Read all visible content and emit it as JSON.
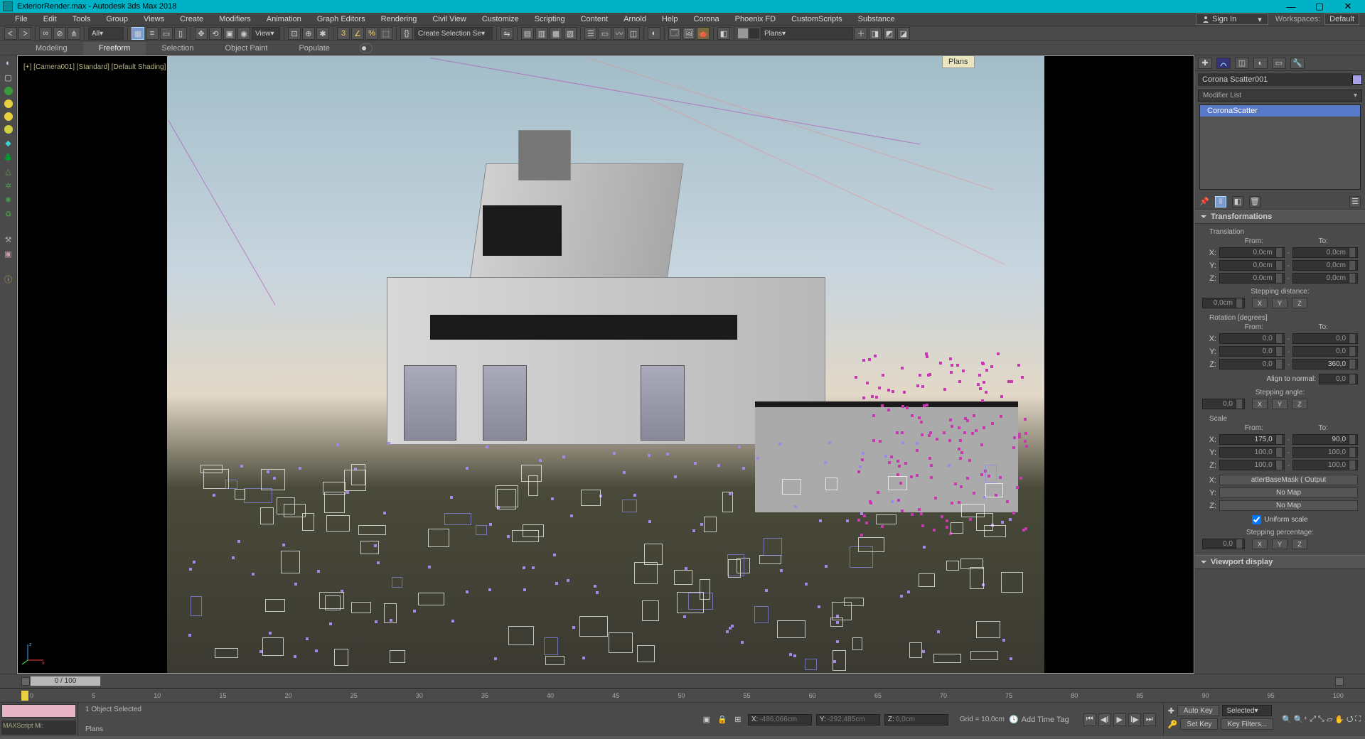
{
  "titlebar": {
    "filename": "ExteriorRender.max - Autodesk 3ds Max 2018"
  },
  "menu": [
    "File",
    "Edit",
    "Tools",
    "Group",
    "Views",
    "Create",
    "Modifiers",
    "Animation",
    "Graph Editors",
    "Rendering",
    "Civil View",
    "Customize",
    "Scripting",
    "Content",
    "Arnold",
    "Help",
    "Corona",
    "Phoenix FD",
    "CustomScripts",
    "Substance"
  ],
  "signin": "Sign In",
  "workspace": {
    "label": "Workspaces:",
    "value": "Default"
  },
  "toolbar": {
    "selset_drop": "All",
    "view_drop": "View",
    "create_sel": "Create Selection Se",
    "plans_drop": "Plans"
  },
  "ribbon": [
    "Modeling",
    "Freeform",
    "Selection",
    "Object Paint",
    "Populate"
  ],
  "ribbon_active": "Freeform",
  "tooltip": "Plans",
  "viewport_label": "[+] [Camera001] [Standard] [Default Shading]",
  "rightpanel": {
    "object_name": "Corona Scatter001",
    "mod_list_label": "Modifier List",
    "modifier": "CoronaScatter",
    "rollout": "Transformations",
    "translation": {
      "label": "Translation",
      "from": "From:",
      "to": "To:",
      "x_from": "0,0cm",
      "x_to": "0,0cm",
      "y_from": "0,0cm",
      "y_to": "0,0cm",
      "z_from": "0,0cm",
      "z_to": "0,0cm",
      "stepdist_label": "Stepping distance:",
      "stepdist": "0,0cm"
    },
    "rotation": {
      "label": "Rotation [degrees]",
      "from": "From:",
      "to": "To:",
      "x_from": "0,0",
      "x_to": "0,0",
      "y_from": "0,0",
      "y_to": "0,0",
      "z_from": "0,0",
      "z_to": "360,0",
      "align_label": "Align to normal:",
      "align": "0,0",
      "stepang_label": "Stepping angle:",
      "stepang": "0,0"
    },
    "scale": {
      "label": "Scale",
      "from": "From:",
      "to": "To:",
      "x_from": "175,0",
      "x_to": "90,0",
      "y_from": "100,0",
      "y_to": "100,0",
      "z_from": "100,0",
      "z_to": "100,0",
      "map_x": "atterBaseMask   ( Output",
      "map_y": "No Map",
      "map_z": "No Map",
      "uniform": "Uniform scale",
      "steppct_label": "Stepping percentage:",
      "steppct": "0,0"
    },
    "next_rollout": "Viewport display"
  },
  "timeline": {
    "pos": "0 / 100",
    "ticks": [
      "0",
      "5",
      "10",
      "15",
      "20",
      "25",
      "30",
      "35",
      "40",
      "45",
      "50",
      "55",
      "60",
      "65",
      "70",
      "75",
      "80",
      "85",
      "90",
      "95",
      "100"
    ]
  },
  "status": {
    "maxscript": "MAXScript Mi:",
    "selected": "1 Object Selected",
    "plans": "Plans",
    "coord_x_lbl": "X:",
    "coord_x": "-486,066cm",
    "coord_y_lbl": "Y:",
    "coord_y": "-292,485cm",
    "coord_z_lbl": "Z:",
    "coord_z": "0,0cm",
    "grid": "Grid = 10,0cm",
    "addtimetag": "Add Time Tag",
    "autokey": "Auto Key",
    "sel_drop": "Selected",
    "setkey": "Set Key",
    "keyfilters": "Key Filters..."
  }
}
